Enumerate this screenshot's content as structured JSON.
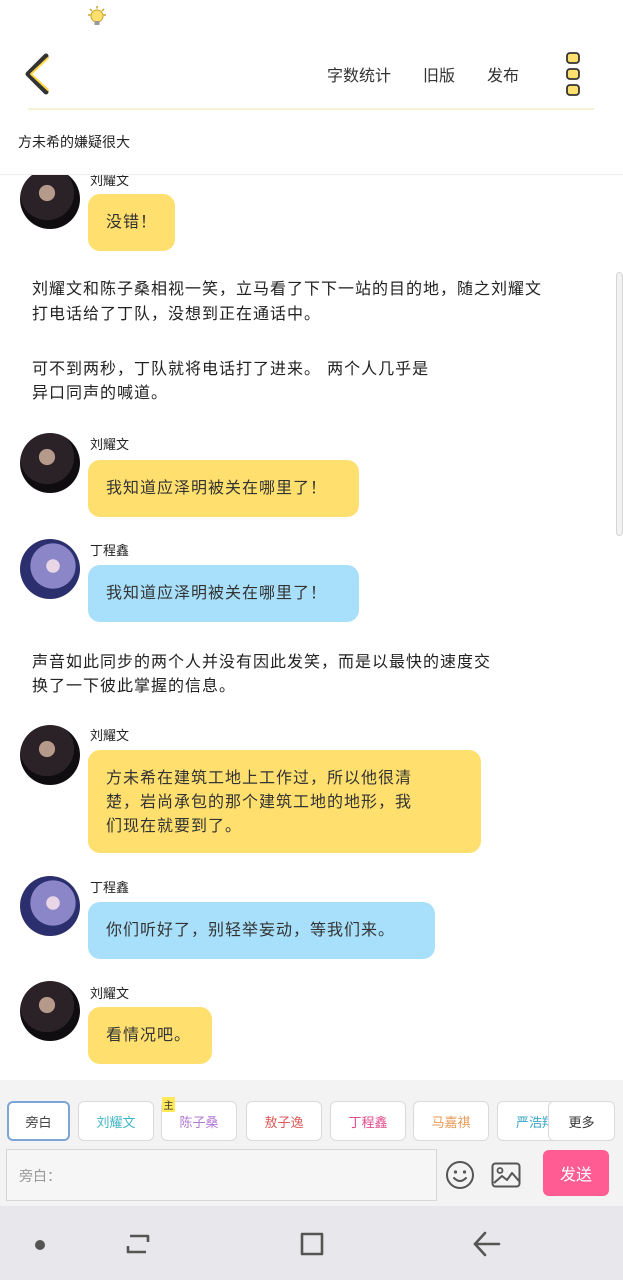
{
  "header": {
    "actions": [
      "字数统计",
      "旧版",
      "发布"
    ],
    "subtitle": "方未希的嫌疑很大"
  },
  "content": {
    "top_name": "刘耀文",
    "top_bubble": "没错！",
    "narration1_line1": "刘耀文和陈子桑相视一笑，立马看了下下一站的目的地，随之刘耀文",
    "narration1_line2": "打电话给了丁队，没想到正在通话中。",
    "narration2_line1": "可不到两秒，丁队就将电话打了进来。 两个人几乎是",
    "narration2_line2": "异口同声的喊道。",
    "msg1_name": "刘耀文",
    "msg1_text": "我知道应泽明被关在哪里了！",
    "msg2_name": "丁程鑫",
    "msg2_text": "我知道应泽明被关在哪里了！",
    "narration3_line1": "声音如此同步的两个人并没有因此发笑，而是以最快的速度交",
    "narration3_line2": "换了一下彼此掌握的信息。",
    "msg3_name": "刘耀文",
    "msg3_line1": "方未希在建筑工地上工作过，所以他很清",
    "msg3_line2": "楚，岩尚承包的那个建筑工地的地形，我",
    "msg3_line3": "们现在就要到了。",
    "msg4_name": "丁程鑫",
    "msg4_text": "你们听好了，别轻举妄动，等我们来。",
    "msg5_name": "刘耀文",
    "msg5_text": "看情况吧。"
  },
  "composer": {
    "chips": [
      {
        "label": "旁白",
        "color": "#444444"
      },
      {
        "label": "刘耀文",
        "color": "#3fb6c7"
      },
      {
        "label": "陈子桑",
        "color": "#b37ad6"
      },
      {
        "label": "敖子逸",
        "color": "#e05a5a"
      },
      {
        "label": "丁程鑫",
        "color": "#e04b8a"
      },
      {
        "label": "马嘉祺",
        "color": "#e89a55"
      },
      {
        "label": "严浩翔",
        "color": "#3aa6c9"
      }
    ],
    "main_badge": "主",
    "more_label": "更多",
    "input_placeholder": "旁白：",
    "send_label": "发送"
  },
  "colors": {
    "yellow_bubble": "#ffe06e",
    "blue_bubble": "#a8e0fb",
    "send_button": "#ff5c93"
  },
  "icons": [
    "lightbulb-icon",
    "back-chevron-icon",
    "more-vertical-icon",
    "emoji-icon",
    "image-icon",
    "nav-recent-icon",
    "nav-home-icon",
    "nav-back-icon"
  ]
}
